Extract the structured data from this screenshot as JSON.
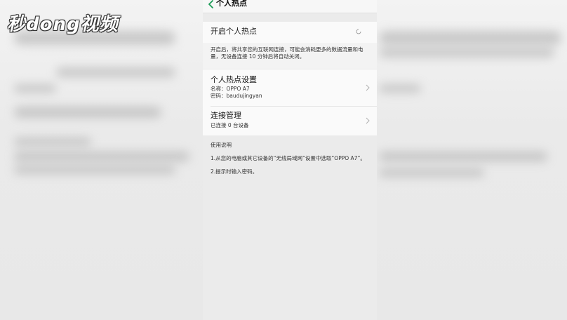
{
  "watermark": {
    "text": "秒dong视频"
  },
  "header": {
    "title": "个人热点",
    "back_icon": "chevron-left-icon",
    "accent": "#1a9b55"
  },
  "hotspot_toggle": {
    "label": "开启个人热点",
    "indicator_icon": "loading-spinner-icon"
  },
  "description": "开启后，将共享您的互联网连接，可能会消耗更多的数据流量和电量，无设备连接 10 分钟后将自动关闭。",
  "hotspot_settings": {
    "title": "个人热点设置",
    "name_line": "名称：OPPO A7",
    "password_line": "密码：baudujingyan",
    "chevron_icon": "chevron-right-icon"
  },
  "connection_management": {
    "title": "连接管理",
    "status": "已连接 0 台设备",
    "chevron_icon": "chevron-right-icon"
  },
  "usage": {
    "title": "使用说明",
    "line1": "1.从您的电脑或其它设备的“无线局域网”设置中选取“OPPO A7”。",
    "line2": "2.提示时输入密码。"
  }
}
